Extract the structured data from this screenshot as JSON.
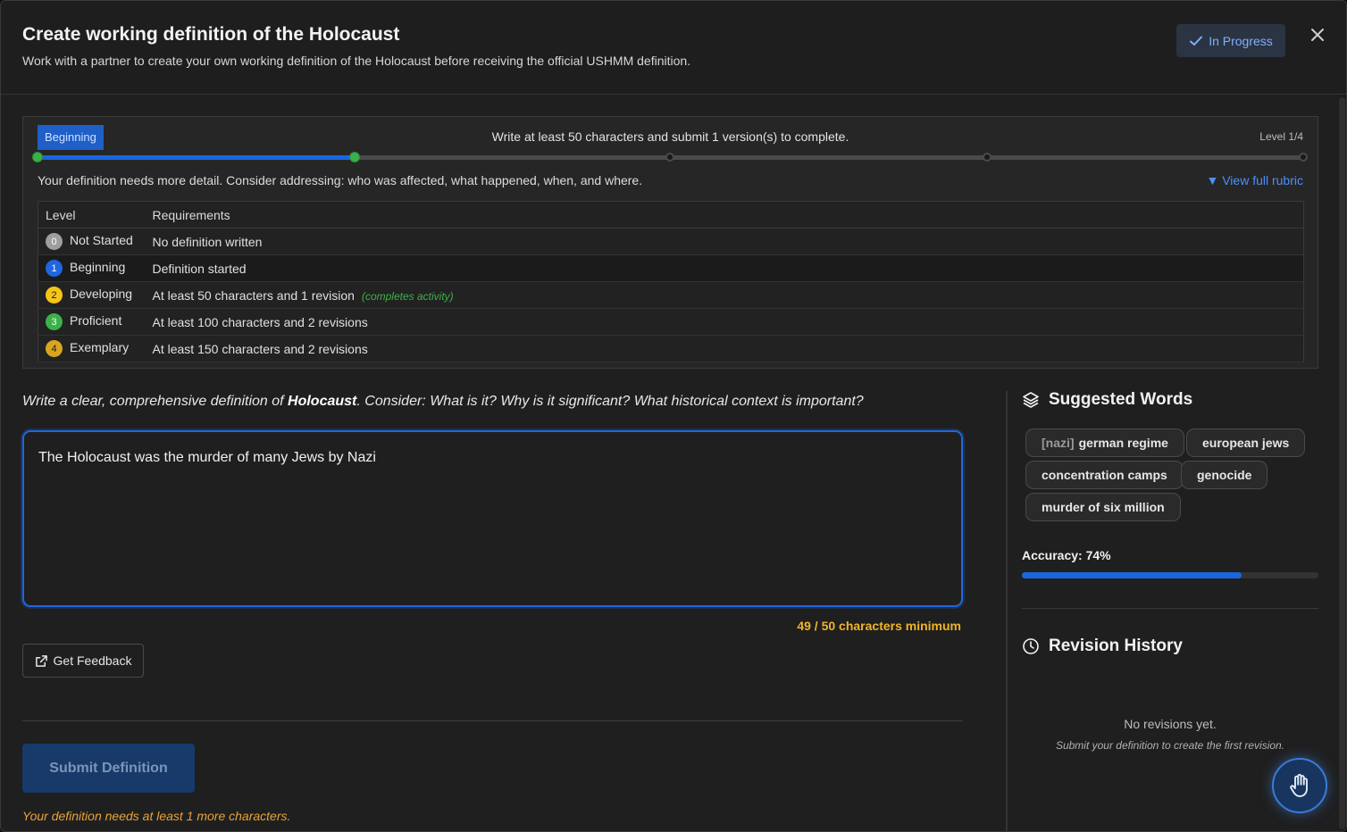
{
  "header": {
    "title": "Create working definition of the Holocaust",
    "subtitle": "Work with a partner to create your own working definition of the Holocaust before receiving the official USHMM definition.",
    "status": "In Progress"
  },
  "progress": {
    "current_level_label": "Beginning",
    "instruction": "Write at least 50 characters and submit 1 version(s) to complete.",
    "level_indicator": "Level 1/4",
    "current_level": 1,
    "max_level": 4,
    "feedback": "Your definition needs more detail. Consider addressing: who was affected, what happened, when, and where.",
    "rubric_link": "▼ View full rubric"
  },
  "rubric": {
    "headers": {
      "level": "Level",
      "requirements": "Requirements"
    },
    "rows": [
      {
        "num": "0",
        "name": "Not Started",
        "req": "No definition written",
        "note": "",
        "color": "#9e9e9e"
      },
      {
        "num": "1",
        "name": "Beginning",
        "req": "Definition started",
        "note": "",
        "color": "#1f66e0"
      },
      {
        "num": "2",
        "name": "Developing",
        "req": "At least 50 characters and 1 revision",
        "note": "(completes activity)",
        "color": "#f5c518"
      },
      {
        "num": "3",
        "name": "Proficient",
        "req": "At least 100 characters and 2 revisions",
        "note": "",
        "color": "#3bb14a"
      },
      {
        "num": "4",
        "name": "Exemplary",
        "req": "At least 150 characters and 2 revisions",
        "note": "",
        "color": "#d9a520"
      }
    ]
  },
  "editor": {
    "prompt_pre": "Write a clear, comprehensive definition of ",
    "prompt_term": "Holocaust",
    "prompt_post": ". Consider: What is it? Why is it significant? What historical context is important?",
    "value": "The Holocaust was the murder of many Jews by Nazi",
    "char_count": "49 / 50 characters minimum",
    "feedback_button": "Get Feedback",
    "submit_button": "Submit Definition",
    "warning": "Your definition needs at least 1 more characters."
  },
  "suggested": {
    "title": "Suggested Words",
    "words": [
      {
        "hint": "[nazi]",
        "text": "german regime"
      },
      {
        "hint": "",
        "text": "european jews"
      },
      {
        "hint": "",
        "text": "concentration camps"
      },
      {
        "hint": "",
        "text": "genocide"
      },
      {
        "hint": "",
        "text": "murder of six million"
      }
    ],
    "accuracy_label": "Accuracy: 74%",
    "accuracy": 0.74
  },
  "revisions": {
    "title": "Revision History",
    "empty_title": "No revisions yet.",
    "empty_sub": "Submit your definition to create the first revision."
  },
  "colors": {
    "accent": "#1f66e0",
    "success": "#3bb14a",
    "warning": "#f0b429"
  }
}
